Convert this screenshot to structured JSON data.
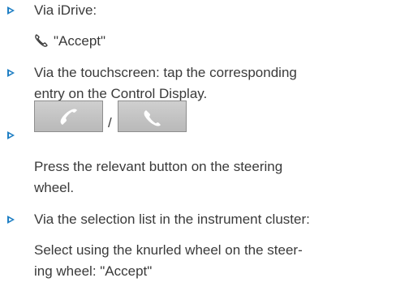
{
  "items": [
    {
      "lines": [
        "Via iDrive:"
      ],
      "sub": "\"Accept\"",
      "sub_icon": "phone-handset-icon"
    },
    {
      "lines": [
        "Via the touchscreen: tap the corresponding",
        "entry on the Control Display."
      ]
    },
    {
      "buttons": [
        {
          "icon": "call-accept-button-icon"
        },
        {
          "icon": "call-end-button-icon"
        }
      ],
      "separator": "/",
      "lines": [
        "Press the relevant button on the steering",
        "wheel."
      ]
    },
    {
      "lines": [
        "Via the selection list in the instrument cluster:",
        "Select using the knurled wheel on the steer-",
        "ing wheel: \"Accept\""
      ]
    }
  ],
  "colors": {
    "bullet": "#1f7fc4",
    "text": "#3a3a3a",
    "button_fill": "#c4c4c4",
    "icon": "#ffffff"
  }
}
